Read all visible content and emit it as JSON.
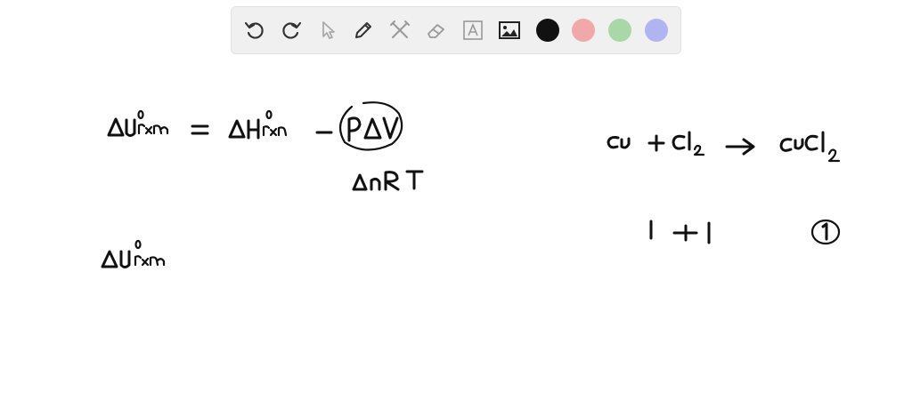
{
  "toolbar": {
    "tools": [
      {
        "name": "undo-icon",
        "enabled": true
      },
      {
        "name": "redo-icon",
        "enabled": true
      },
      {
        "name": "pointer-icon",
        "enabled": false
      },
      {
        "name": "pen-icon",
        "enabled": true
      },
      {
        "name": "tools-icon",
        "enabled": false
      },
      {
        "name": "eraser-icon",
        "enabled": false
      },
      {
        "name": "text-icon",
        "enabled": false
      },
      {
        "name": "image-icon",
        "enabled": true
      }
    ],
    "colors": [
      "#111111",
      "#f0a8a8",
      "#a8d8a8",
      "#b0b4f0"
    ],
    "selected_color": "#111111"
  },
  "canvas": {
    "note": ""
  }
}
